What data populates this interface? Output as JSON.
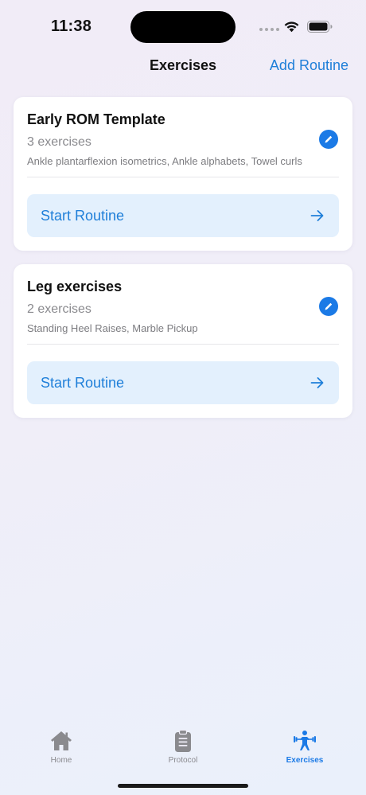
{
  "status_bar": {
    "time": "11:38"
  },
  "nav": {
    "title": "Exercises",
    "action_label": "Add Routine"
  },
  "routines": [
    {
      "title": "Early ROM Template",
      "count": "3 exercises",
      "exercises": "Ankle plantarflexion isometrics, Ankle alphabets, Towel curls",
      "start_label": "Start Routine"
    },
    {
      "title": "Leg exercises",
      "count": "2 exercises",
      "exercises": "Standing Heel Raises, Marble Pickup",
      "start_label": "Start Routine"
    }
  ],
  "tabs": [
    {
      "label": "Home",
      "icon": "house-icon",
      "active": false
    },
    {
      "label": "Protocol",
      "icon": "clipboard-icon",
      "active": false
    },
    {
      "label": "Exercises",
      "icon": "weightlifter-icon",
      "active": true
    }
  ],
  "colors": {
    "accent": "#1b7ae6",
    "link": "#1f7fd9",
    "start_button_bg": "#e3f0fd",
    "inactive_tab": "#8a8a8e"
  }
}
